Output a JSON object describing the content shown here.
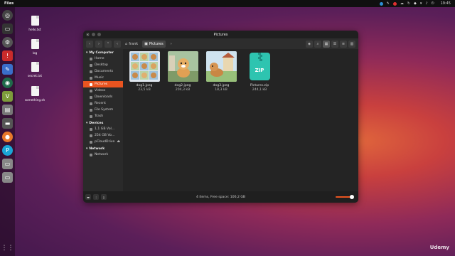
{
  "topbar": {
    "app_name": "Files",
    "time": "19:45"
  },
  "desktop": {
    "files": [
      {
        "name": "hello.txt"
      },
      {
        "name": "log"
      },
      {
        "name": "secret.txt"
      },
      {
        "name": "something.sh"
      }
    ]
  },
  "window": {
    "title": "Pictures",
    "breadcrumbs": [
      {
        "label": "frank"
      },
      {
        "label": "Pictures"
      }
    ]
  },
  "sidebar": {
    "sections": [
      {
        "header": "My Computer",
        "items": [
          "Home",
          "Desktop",
          "Documents",
          "Music",
          "Pictures",
          "Videos",
          "Downloads",
          "Recent",
          "File System",
          "Trash"
        ]
      },
      {
        "header": "Devices",
        "items": [
          "1,1 GB Vol...",
          "254 GB Vo...",
          "pCloudDrive"
        ]
      },
      {
        "header": "Network",
        "items": [
          "Network"
        ]
      }
    ],
    "selected": "Pictures"
  },
  "files": [
    {
      "name": "dog1.jpeg",
      "size": "23,5 kB",
      "kind": "image"
    },
    {
      "name": "dog2.jpeg",
      "size": "204,3 kB",
      "kind": "image"
    },
    {
      "name": "dog3.jpeg",
      "size": "18,3 kB",
      "kind": "image"
    },
    {
      "name": "Pictures.zip",
      "size": "244,1 kB",
      "kind": "zip",
      "label": "ZIP"
    }
  ],
  "status": {
    "text": "4 items, Free space: 106,2 GB"
  },
  "colors": {
    "accent": "#e95420",
    "window_bg": "#242424"
  },
  "watermark": "Udemy"
}
